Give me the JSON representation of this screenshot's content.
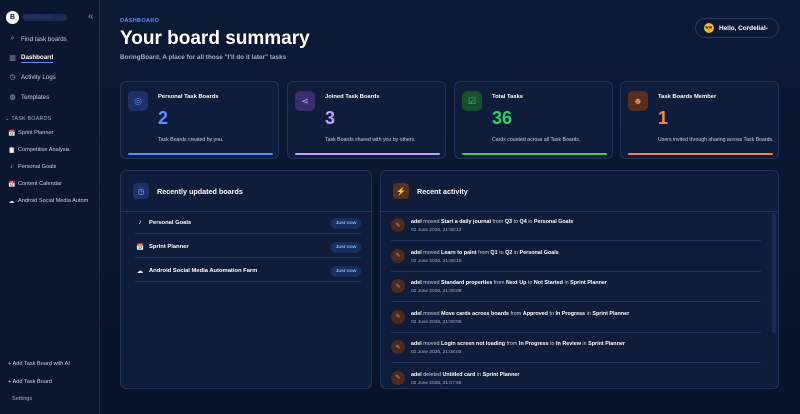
{
  "sidebar": {
    "brand_logo": "B",
    "brand_name": "BoringBoard",
    "collapse": "«",
    "search": "Find task boards",
    "nav": [
      {
        "label": "Dashboard",
        "icon": "chart-icon"
      },
      {
        "label": "Activity Logs",
        "icon": "clock-icon"
      },
      {
        "label": "Templates",
        "icon": "globe-icon"
      }
    ],
    "section": "TASK BOARDS",
    "boards": [
      {
        "label": "Sprint Planner",
        "glyph": "📅"
      },
      {
        "label": "Competitive Analysis",
        "glyph": "📋"
      },
      {
        "label": "Personal Goals",
        "glyph": "♪"
      },
      {
        "label": "Content Calendar",
        "glyph": "📅"
      },
      {
        "label": "Android Social Media Autom",
        "glyph": "☁"
      }
    ],
    "add_ai": "+ Add Task Board with AI",
    "add": "+ Add Task Board",
    "settings": "Settings"
  },
  "header": {
    "crumb": "DASHBOARD",
    "title": "Your board summary",
    "subtitle": "BoringBoard, A place for all those \"I'll do it later\" tasks",
    "user": "Hello, Cordelia!",
    "user_emoji": "😎",
    "chevron": "⌄"
  },
  "stats": [
    {
      "label": "Personal Task Boards",
      "value": "2",
      "desc": "Task Boards created by you.",
      "color": "#5b8cff",
      "icon": "target-icon",
      "glyph": "◎",
      "icon_bg": "#1f2f6a"
    },
    {
      "label": "Joined Task Boards",
      "value": "3",
      "desc": "Task Boards shared with you by others.",
      "color": "#b6a4ff",
      "icon": "share-icon",
      "glyph": "⋖",
      "icon_bg": "#3a2d6e"
    },
    {
      "label": "Total Tasks",
      "value": "36",
      "desc": "Cards counted across all Task Boards.",
      "color": "#2fd06a",
      "icon": "checklist-icon",
      "glyph": "☑",
      "icon_bg": "#16502f"
    },
    {
      "label": "Task Boards Member",
      "value": "1",
      "desc": "Users invited through sharing across Task Boards.",
      "color": "#f2894a",
      "icon": "user-icon",
      "glyph": "☻",
      "icon_bg": "#5a2e1e"
    }
  ],
  "recent_boards": {
    "title": "Recently updated boards",
    "items": [
      {
        "name": "Personal Goals",
        "glyph": "♪",
        "badge": "Just now"
      },
      {
        "name": "Sprint Planner",
        "glyph": "📅",
        "badge": "Just now"
      },
      {
        "name": "Android Social Media Automation Farm",
        "glyph": "☁",
        "badge": "Just now"
      }
    ]
  },
  "activity": {
    "title": "Recent activity",
    "items": [
      {
        "user": "adel",
        "verb": "moved",
        "card": "Start a daily journal",
        "from_label": "from",
        "from": "Q3",
        "to_label": "to",
        "to": "Q4",
        "in_label": "in",
        "board": "Personal Goals",
        "time": "02 June 2026, 21:08:12"
      },
      {
        "user": "adel",
        "verb": "moved",
        "card": "Learn to paint",
        "from_label": "from",
        "from": "Q1",
        "to_label": "to",
        "to": "Q2",
        "in_label": "in",
        "board": "Personal Goals",
        "time": "02 June 2026, 21:08:10"
      },
      {
        "user": "adel",
        "verb": "moved",
        "card": "Standard properties",
        "from_label": "from",
        "from": "Next Up",
        "to_label": "to",
        "to": "Not Started",
        "in_label": "in",
        "board": "Sprint Planner",
        "time": "02 June 2026, 21:08:08"
      },
      {
        "user": "adel",
        "verb": "moved",
        "card": "Move cards across boards",
        "from_label": "from",
        "from": "Approved",
        "to_label": "to",
        "to": "In Progress",
        "in_label": "in",
        "board": "Sprint Planner",
        "time": "02 June 2026, 21:08:06"
      },
      {
        "user": "adel",
        "verb": "moved",
        "card": "Login screen not loading",
        "from_label": "from",
        "from": "In Progress",
        "to_label": "to",
        "to": "In Review",
        "in_label": "in",
        "board": "Sprint Planner",
        "time": "02 June 2026, 21:08:03"
      },
      {
        "user": "adel",
        "verb": "deleted",
        "card": "Untitled card",
        "from_label": "",
        "from": "",
        "to_label": "",
        "to": "",
        "in_label": "in",
        "board": "Sprint Planner",
        "time": "02 June 2026, 21:07:58"
      }
    ]
  }
}
